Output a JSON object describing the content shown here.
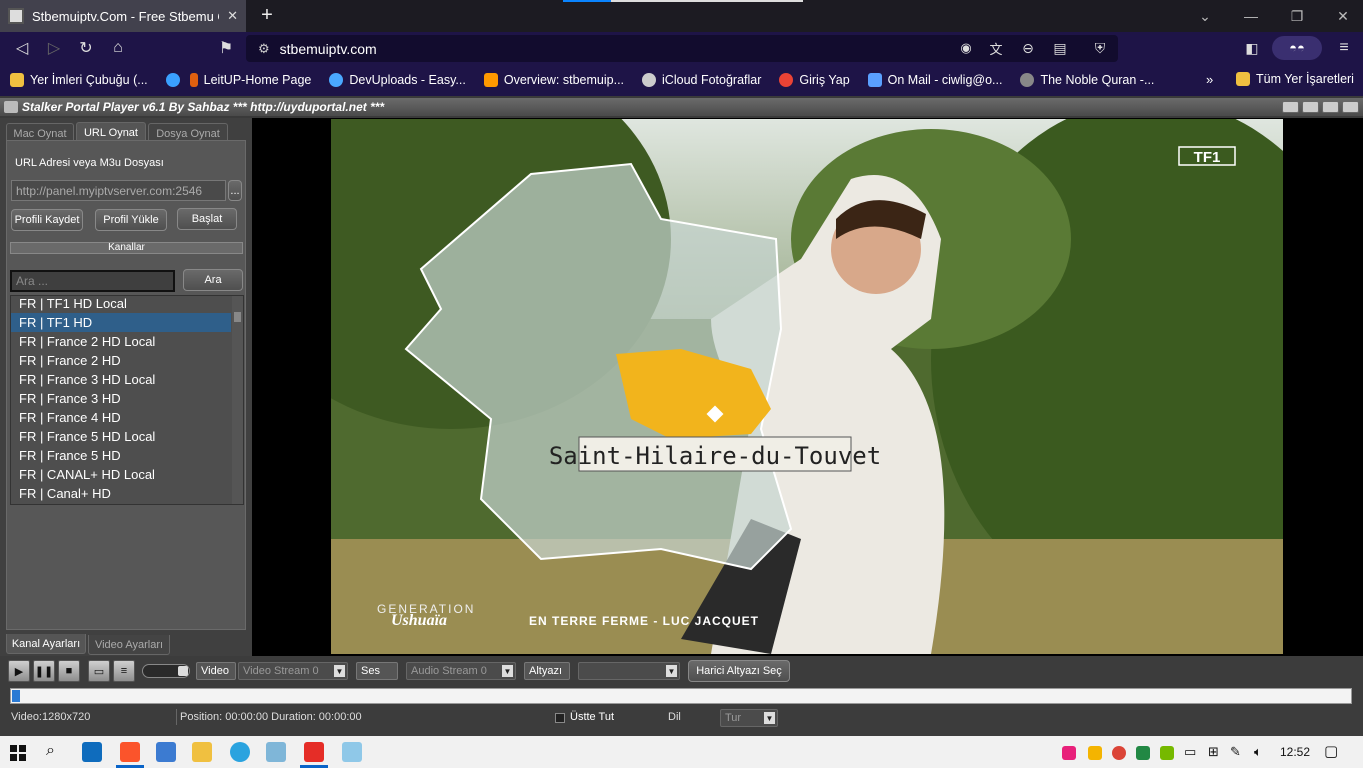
{
  "browser": {
    "tab_title": "Stbemuiptv.Com - Free Stbemu C",
    "url": "stbemuiptv.com",
    "bookmarks": [
      {
        "label": "Yer İmleri Çubuğu (...",
        "icon": "folder-icon",
        "color": "#f0c040"
      },
      {
        "label": "",
        "icon": "swirl-icon",
        "color": "#3aa0ff"
      },
      {
        "label": "LeitUP-Home Page",
        "icon": "leitup-icon",
        "color": "#e06010"
      },
      {
        "label": "DevUploads - Easy...",
        "icon": "cloud-icon",
        "color": "#4aa8ff"
      },
      {
        "label": "Overview: stbemuip...",
        "icon": "amazon-icon",
        "color": "#ff9900"
      },
      {
        "label": "iCloud Fotoğraflar",
        "icon": "apple-icon",
        "color": "#cccccc"
      },
      {
        "label": "Giriş Yap",
        "icon": "google-icon",
        "color": "#ea4335"
      },
      {
        "label": "On Mail - ciwlig@o...",
        "icon": "mail-icon",
        "color": "#5aa0ff"
      },
      {
        "label": "The Noble Quran -...",
        "icon": "quran-icon",
        "color": "#888888"
      }
    ],
    "all_bookmarks": "Tüm Yer İşaretleri"
  },
  "app": {
    "title": "Stalker Portal Player v6.1 By Sahbaz  *** http://uyduportal.net ***",
    "tabs": [
      "Mac Oynat",
      "URL Oynat",
      "Dosya Oynat"
    ],
    "active_tab": 1,
    "url_label": "URL Adresi veya M3u Dosyası",
    "url_value": "http://panel.myiptvserver.com:2546",
    "browse_btn": "...",
    "save_profile": "Profili Kaydet",
    "load_profile": "Profil Yükle",
    "start": "Başlat",
    "channels_header": "Kanallar",
    "search_placeholder": "Ara ...",
    "search_btn": "Ara",
    "channels": [
      "FR | TF1 HD Local",
      "FR | TF1 HD",
      "FR | France 2 HD Local",
      "FR | France 2 HD",
      "FR | France 3 HD Local",
      "FR | France 3 HD",
      "FR | France 4 HD",
      "FR | France 5 HD Local",
      "FR | France 5 HD",
      "FR | CANAL+ HD Local",
      "FR | Canal+ HD"
    ],
    "selected_channel": 1,
    "bottom_tabs": [
      "Kanal Ayarları",
      "Video Ayarları"
    ],
    "video_overlay": {
      "place": "Saint-Hilaire-du-Touvet",
      "brand_top": "GENERATION",
      "brand_bottom": "Ushuaïa",
      "caption": "EN TERRE FERME - LUC JACQUET",
      "channel_logo": "TF1"
    },
    "controls": {
      "video_label": "Video",
      "video_stream": "Video Stream 0",
      "audio_label": "Ses",
      "audio_stream": "Audio Stream 0",
      "subtitle_label": "Altyazı",
      "subtitle_value": "",
      "external_subtitle": "Harici Altyazı Seç"
    },
    "status": {
      "video": "Video:1280x720",
      "position": "Position: 00:00:00 Duration: 00:00:00",
      "on_top": "Üstte Tut",
      "lang_label": "Dil",
      "lang_value": "Tur"
    }
  },
  "taskbar": {
    "time": "12:52"
  }
}
